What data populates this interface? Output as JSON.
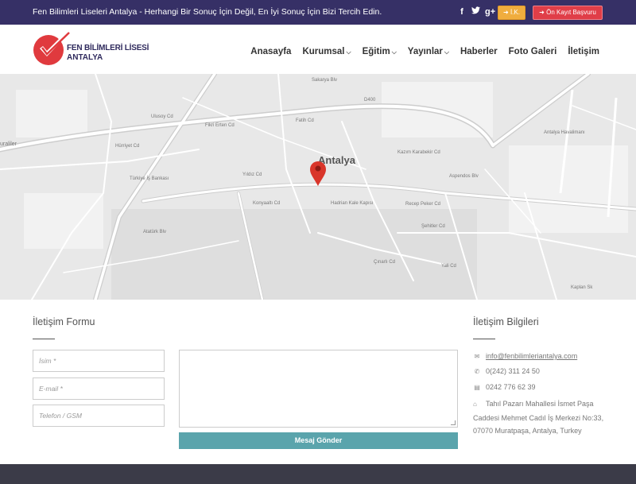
{
  "topbar": {
    "tagline": "Fen Bilimleri Liseleri Antalya - Herhangi Bir Sonuç İçin Değil, En İyi Sonuç İçin Bizi Tercih Edin.",
    "social": {
      "facebook": "f",
      "twitter": "t",
      "googleplus": "g+"
    },
    "ik_label": "İ.K.",
    "register_label": "Ön Kayıt Başvuru"
  },
  "logo": {
    "line1": "FEN BİLİMLERİ LİSESİ",
    "line2": "ANTALYA"
  },
  "nav": {
    "items": [
      {
        "label": "Anasayfa",
        "dropdown": false
      },
      {
        "label": "Kurumsal",
        "dropdown": true
      },
      {
        "label": "Eğitim",
        "dropdown": true
      },
      {
        "label": "Yayınlar",
        "dropdown": true
      },
      {
        "label": "Haberler",
        "dropdown": false
      },
      {
        "label": "Foto Galeri",
        "dropdown": false
      },
      {
        "label": "İletişim",
        "dropdown": false
      }
    ]
  },
  "map": {
    "city_label": "Antalya",
    "labels": [
      "Sakarya Blv",
      "D400",
      "Ulusoy Cd",
      "Fikri Erten Cd",
      "Hürriyet Cd",
      "Türkiye İş Bankası",
      "Yıldız Cd",
      "Konyaaltı Cd",
      "Hadrian Kale Kapısı",
      "Atatürk Blv",
      "Şehitler Cd",
      "Yali Cd",
      "Çınarlı Cd",
      "Antalya Havalimanı",
      "Kaplan Sk",
      "Aspendos Blv",
      "Kazım Karabekir Cd",
      "uraliler",
      "Fatih Cd",
      "Recep Peker Cd"
    ]
  },
  "form": {
    "title": "İletişim Formu",
    "name_placeholder": "İsim *",
    "email_placeholder": "E-mail *",
    "phone_placeholder": "Telefon / GSM",
    "send_label": "Mesaj Gönder"
  },
  "info": {
    "title": "İletişim Bilgileri",
    "email": "info@fenbilimleriantalya.com",
    "phone": "0(242) 311 24 50",
    "fax": "0242 776 62 39",
    "address": "Tahıl Pazarı Mahallesi İsmet Paşa Caddesi Mehmet Cadıl İş Merkezi No:33, 07070 Muratpaşa, Antalya, Turkey"
  },
  "colors": {
    "topbar": "#363066",
    "accent_red": "#e03e48",
    "accent_orange": "#f0ad3e",
    "send_button": "#5aa4ac",
    "footer": "#3b3b48"
  }
}
